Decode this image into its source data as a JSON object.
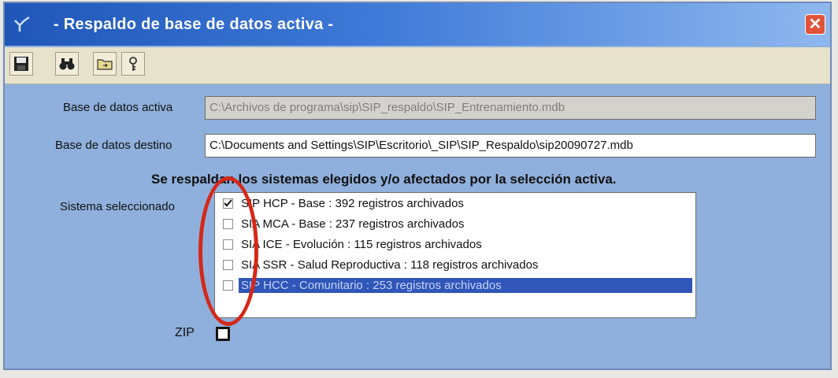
{
  "window": {
    "title": "- Respaldo de base de datos activa -",
    "close_label": "✕"
  },
  "toolbar": {
    "buttons": [
      "save-icon",
      "binoculars-icon",
      "folder-icon",
      "key-icon"
    ]
  },
  "form": {
    "db_active_label": "Base de datos activa",
    "db_active_value": "C:\\Archivos de programa\\sip\\SIP_respaldo\\SIP_Entrenamiento.mdb",
    "db_dest_label": "Base de datos destino",
    "db_dest_value": "C:\\Documents and Settings\\SIP\\Escritorio\\_SIP\\SIP_Respaldo\\sip20090727.mdb",
    "info_text": "Se respaldan los sistemas elegidos y/o afectados por la selección activa.",
    "system_label": "Sistema seleccionado",
    "systems": [
      {
        "label": "SIP HCP - Base : 392 registros archivados",
        "checked": true,
        "selected": false
      },
      {
        "label": "SIA MCA - Base : 237 registros archivados",
        "checked": false,
        "selected": false
      },
      {
        "label": "SIA ICE - Evolución : 115 registros archivados",
        "checked": false,
        "selected": false
      },
      {
        "label": "SIA SSR - Salud Reproductiva : 118 registros archivados",
        "checked": false,
        "selected": false
      },
      {
        "label": "SIP HCC - Comunitario : 253 registros archivados",
        "checked": false,
        "selected": true
      }
    ],
    "zip_label": "ZIP",
    "zip_checked": false
  },
  "colors": {
    "window_bg": "#8fb0dc",
    "selection": "#2f56b8",
    "annotation": "#d52818"
  }
}
